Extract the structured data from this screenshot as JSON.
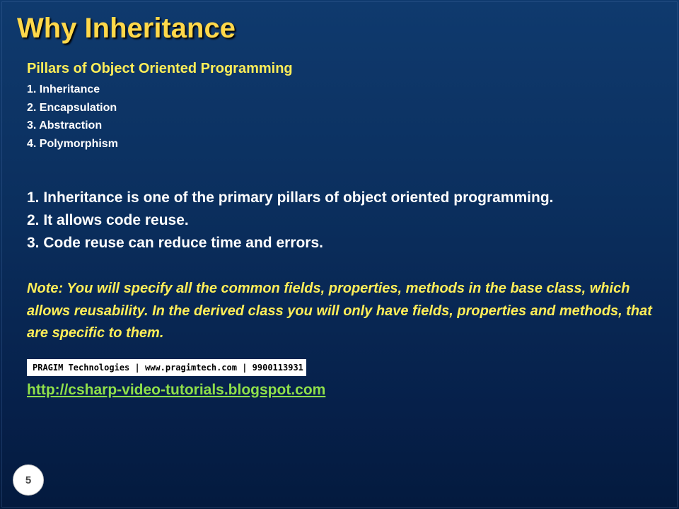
{
  "slide": {
    "title": "Why Inheritance",
    "pillars_heading": "Pillars of Object Oriented Programming",
    "pillars": [
      "1. Inheritance",
      "2. Encapsulation",
      "3. Abstraction",
      "4. Polymorphism"
    ],
    "points": [
      "1. Inheritance is one of the primary pillars of object oriented programming.",
      "2. It allows code reuse.",
      "3. Code reuse can reduce time and errors."
    ],
    "note": "Note: You will specify all the common fields, properties, methods in the base class, which allows reusability. In the derived class you will only have fields, properties and methods, that are specific to them.",
    "company_info": "PRAGIM Technologies | www.pragimtech.com | 9900113931",
    "link": "http://csharp-video-tutorials.blogspot.com",
    "page_number": "5"
  },
  "colors": {
    "title": "#ffd84a",
    "heading": "#ffee58",
    "link": "#8fe04a",
    "background": "#0b2f5e"
  }
}
